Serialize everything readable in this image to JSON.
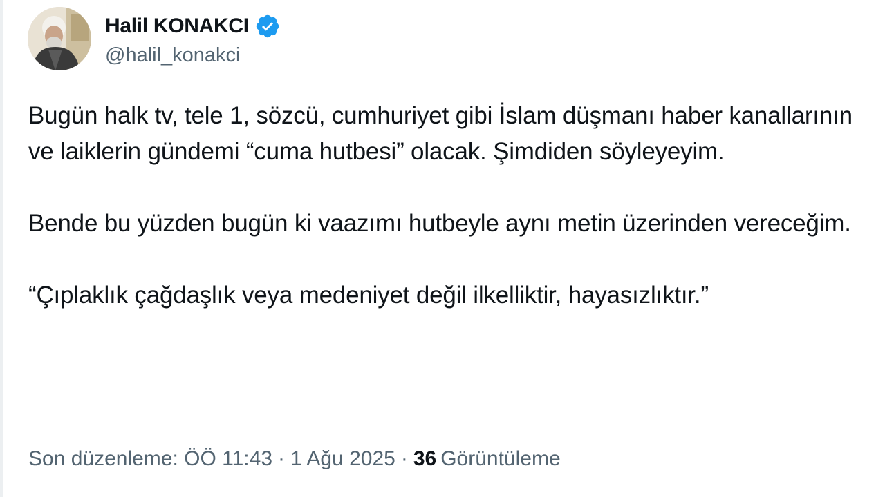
{
  "author": {
    "display_name": "Halil KONAKCI",
    "handle": "@halil_konakci",
    "verified": true,
    "verified_icon": "verified-badge-icon",
    "verified_color": "#1d9bf0"
  },
  "tweet": {
    "paragraphs": [
      "Bugün halk tv, tele 1, sözcü, cumhuriyet gibi İslam düşmanı haber kanallarının ve laiklerin gündemi “cuma hutbesi” olacak. Şimdiden söyleyeyim.",
      "Bende bu yüzden bugün ki vaazımı hutbeyle aynı metin üzerinden vereceğim.",
      "“Çıplaklık çağdaşlık veya medeniyet değil ilkelliktir, hayasızlıktır.”"
    ]
  },
  "meta": {
    "edited_label": "Son düzenleme: ÖÖ 11:43",
    "separator": "·",
    "date": "1 Ağu 2025",
    "views_count": "36",
    "views_label": "Görüntüleme"
  },
  "colors": {
    "text": "#0f1419",
    "secondary": "#536471",
    "accent": "#1d9bf0"
  }
}
